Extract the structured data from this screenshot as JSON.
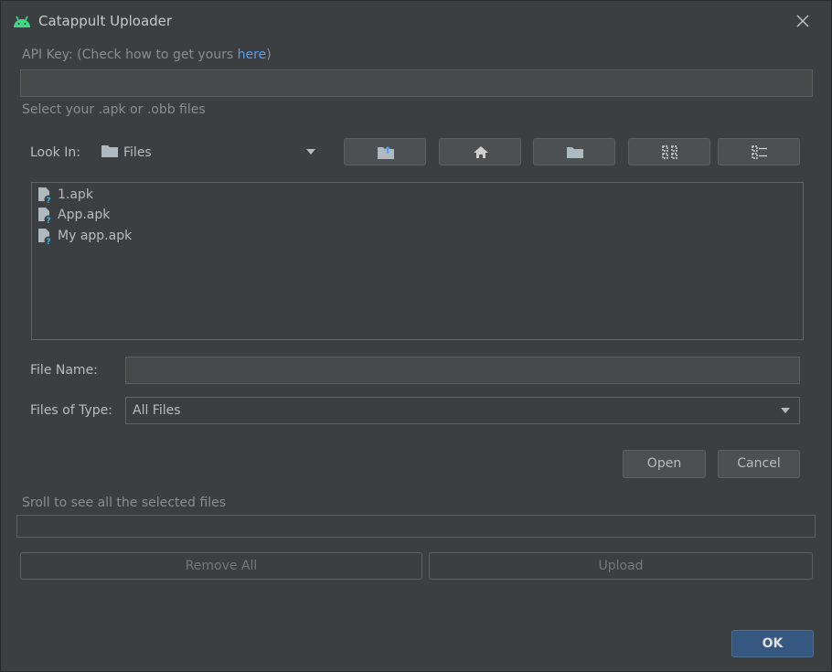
{
  "window": {
    "title": "Catappult Uploader"
  },
  "api_key": {
    "label_prefix": "API Key: (Check how to get yours ",
    "link_text": "here",
    "label_suffix": ")",
    "value": ""
  },
  "select_label": "Select your .apk or .obb files",
  "file_chooser": {
    "look_in_label": "Look In:",
    "look_in_value": "Files",
    "toolbar": [
      "up-one-level",
      "home",
      "new-folder",
      "list-view",
      "details-view"
    ],
    "files": [
      {
        "name": "1.apk"
      },
      {
        "name": "App.apk"
      },
      {
        "name": "My app.apk"
      }
    ],
    "file_name_label": "File Name:",
    "file_name_value": "",
    "files_of_type_label": "Files of Type:",
    "files_of_type_value": "All Files",
    "open_label": "Open",
    "cancel_label": "Cancel"
  },
  "selected_files_label": "Sroll to see all the selected files",
  "remove_all_label": "Remove All",
  "upload_label": "Upload",
  "ok_label": "OK",
  "colors": {
    "background": "#3c3f41",
    "accent_link": "#589df6",
    "ok_button": "#365880",
    "android_green": "#3ddc84"
  }
}
